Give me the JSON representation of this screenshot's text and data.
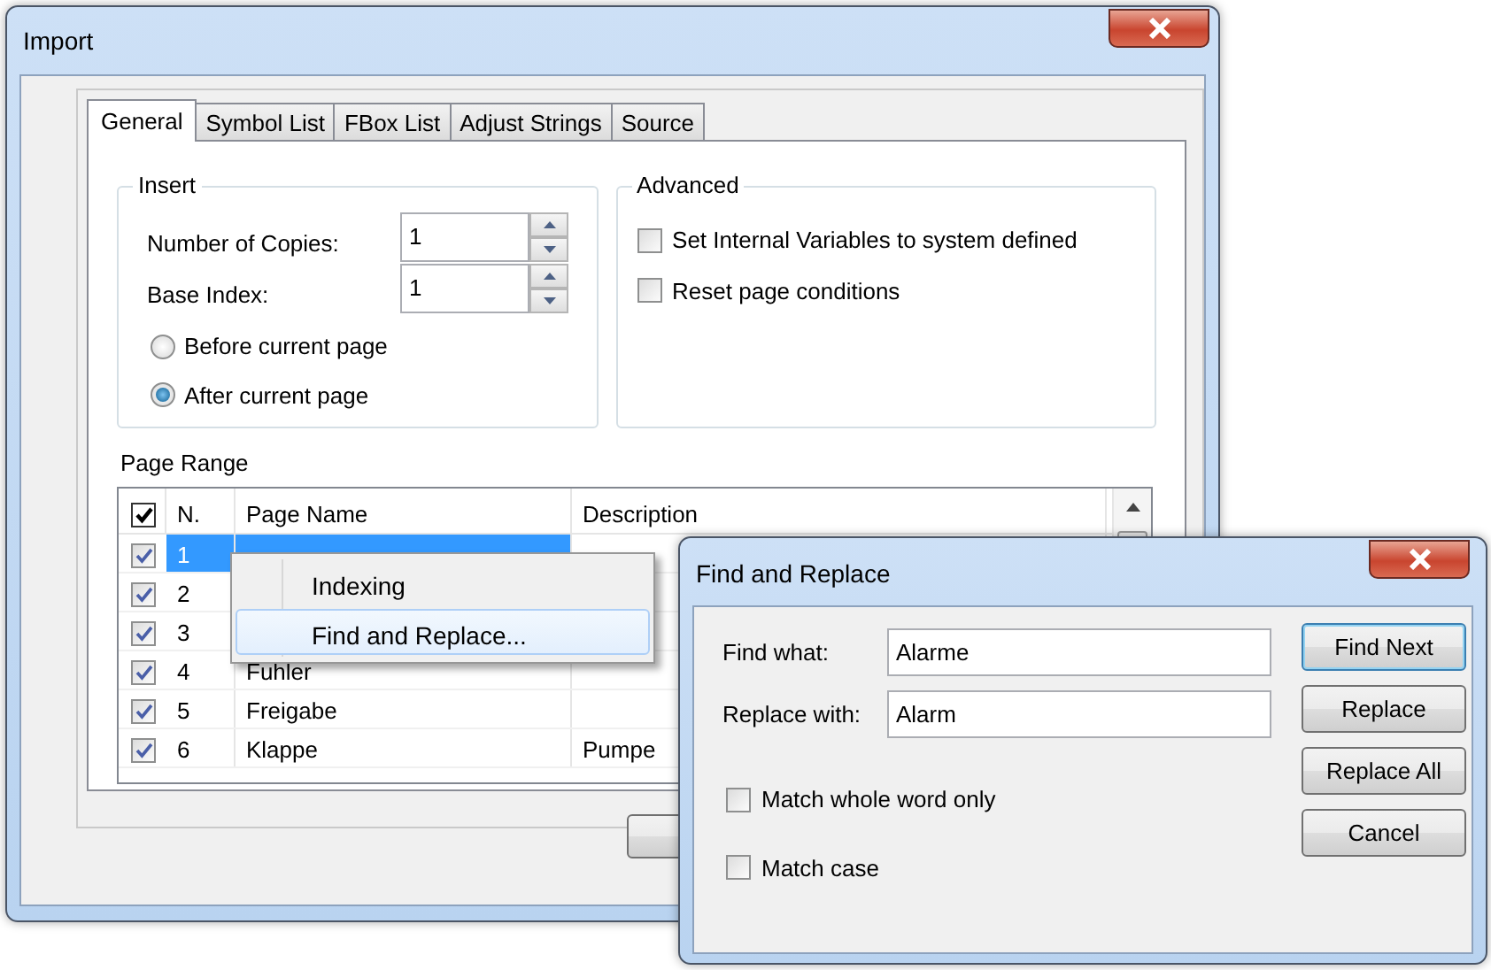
{
  "import_window": {
    "title": "Import",
    "tabs": [
      {
        "label": "General",
        "selected": true
      },
      {
        "label": "Symbol List",
        "selected": false
      },
      {
        "label": "FBox List",
        "selected": false
      },
      {
        "label": "Adjust Strings",
        "selected": false
      },
      {
        "label": "Source",
        "selected": false
      }
    ],
    "insert": {
      "title": "Insert",
      "fields": [
        {
          "label": "Number of Copies:",
          "value": "1"
        },
        {
          "label": "Base Index:",
          "value": "1"
        }
      ],
      "options": [
        {
          "label": "Before current page",
          "selected": false
        },
        {
          "label": "After current page",
          "selected": true
        }
      ]
    },
    "advanced": {
      "title": "Advanced",
      "options": [
        {
          "label": "Set Internal Variables to system defined",
          "checked": false
        },
        {
          "label": "Reset page conditions",
          "checked": false
        }
      ]
    },
    "page_range": {
      "title": "Page Range",
      "select_all_checked": true,
      "columns": [
        "N.",
        "Page Name",
        "Description"
      ],
      "rows": [
        {
          "checked": true,
          "number": "1",
          "selected": true
        },
        {
          "checked": true,
          "number": "2",
          "selected": false
        },
        {
          "checked": true,
          "number": "3",
          "selected": false
        },
        {
          "checked": true,
          "number": "4",
          "page_name": "Fuhler",
          "selected": false
        },
        {
          "checked": true,
          "number": "5",
          "page_name": "Freigabe",
          "selected": false
        },
        {
          "checked": true,
          "number": "6",
          "page_name": "Klappe",
          "description": "Pumpe",
          "selected": false
        }
      ]
    }
  },
  "context_menu": {
    "items": [
      {
        "label": "Indexing",
        "selected": false
      },
      {
        "label": "Find and Replace...",
        "selected": true
      }
    ]
  },
  "find_replace_dialog": {
    "title": "Find and Replace",
    "fields": [
      {
        "label": "Find what:",
        "value": "Alarme"
      },
      {
        "label": "Replace with:",
        "value": "Alarm"
      }
    ],
    "options": [
      {
        "label": "Match whole word only",
        "checked": false
      },
      {
        "label": "Match case",
        "checked": false
      }
    ],
    "buttons": [
      {
        "label": "Find Next",
        "default": true
      },
      {
        "label": "Replace",
        "default": false
      },
      {
        "label": "Replace All",
        "default": false
      },
      {
        "label": "Cancel",
        "default": false
      }
    ]
  }
}
